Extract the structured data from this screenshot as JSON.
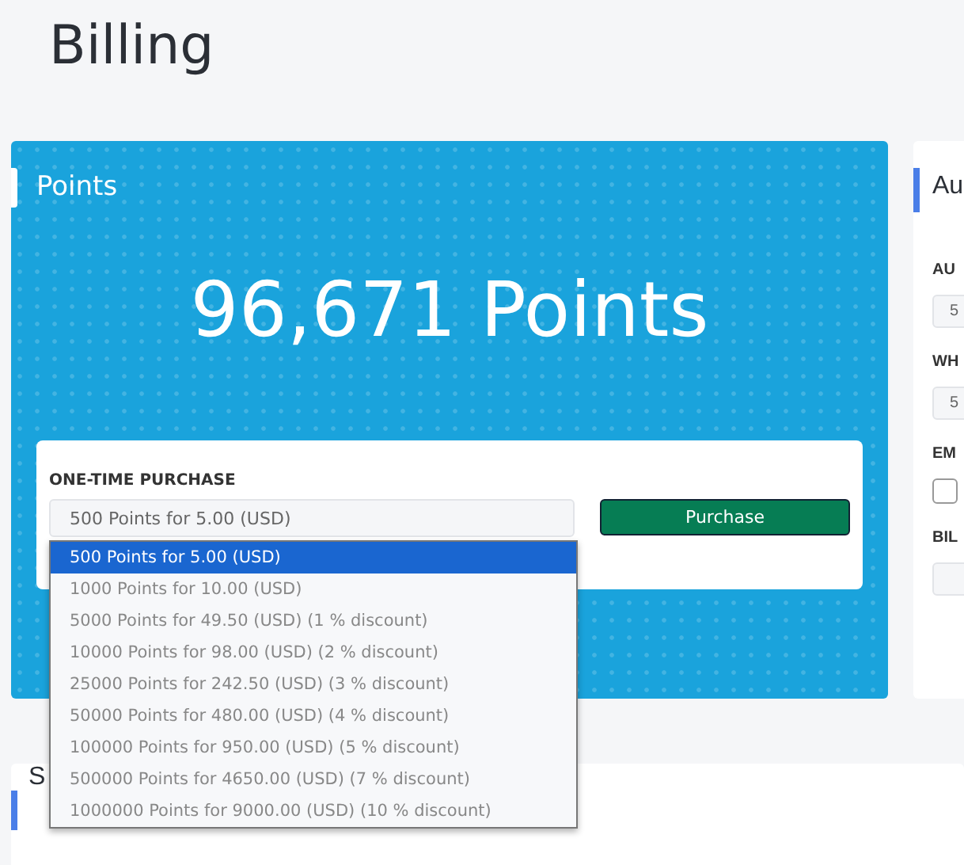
{
  "page": {
    "title": "Billing"
  },
  "points_card": {
    "title": "Points",
    "balance": "96,671 Points",
    "purchase": {
      "label": "ONE-TIME PURCHASE",
      "select_value": "500 Points for 5.00 (USD)",
      "button": "Purchase",
      "dropdown": {
        "expanded": true,
        "options": [
          {
            "label": "500 Points for 5.00 (USD)",
            "selected": true
          },
          {
            "label": "1000 Points for 10.00 (USD)",
            "selected": false
          },
          {
            "label": "5000 Points for 49.50 (USD) (1 % discount)",
            "selected": false
          },
          {
            "label": "10000 Points for 98.00 (USD) (2 % discount)",
            "selected": false
          },
          {
            "label": "25000 Points for 242.50 (USD) (3 % discount)",
            "selected": false
          },
          {
            "label": "50000 Points for 480.00 (USD) (4 % discount)",
            "selected": false
          },
          {
            "label": "100000 Points for 950.00 (USD) (5 % discount)",
            "selected": false
          },
          {
            "label": "500000 Points for 4650.00 (USD) (7 % discount)",
            "selected": false
          },
          {
            "label": "1000000 Points for 9000.00 (USD) (10 % discount)",
            "selected": false
          }
        ]
      }
    }
  },
  "side_card": {
    "title": "Au",
    "fields": [
      {
        "kind": "select",
        "label": "AU",
        "value": "5"
      },
      {
        "kind": "select",
        "label": "WH",
        "value": "5"
      },
      {
        "kind": "checkbox",
        "label": "EM",
        "checked": false
      },
      {
        "kind": "select",
        "label": "BIL"
      }
    ]
  },
  "bottom_card": {
    "title": "S"
  }
}
